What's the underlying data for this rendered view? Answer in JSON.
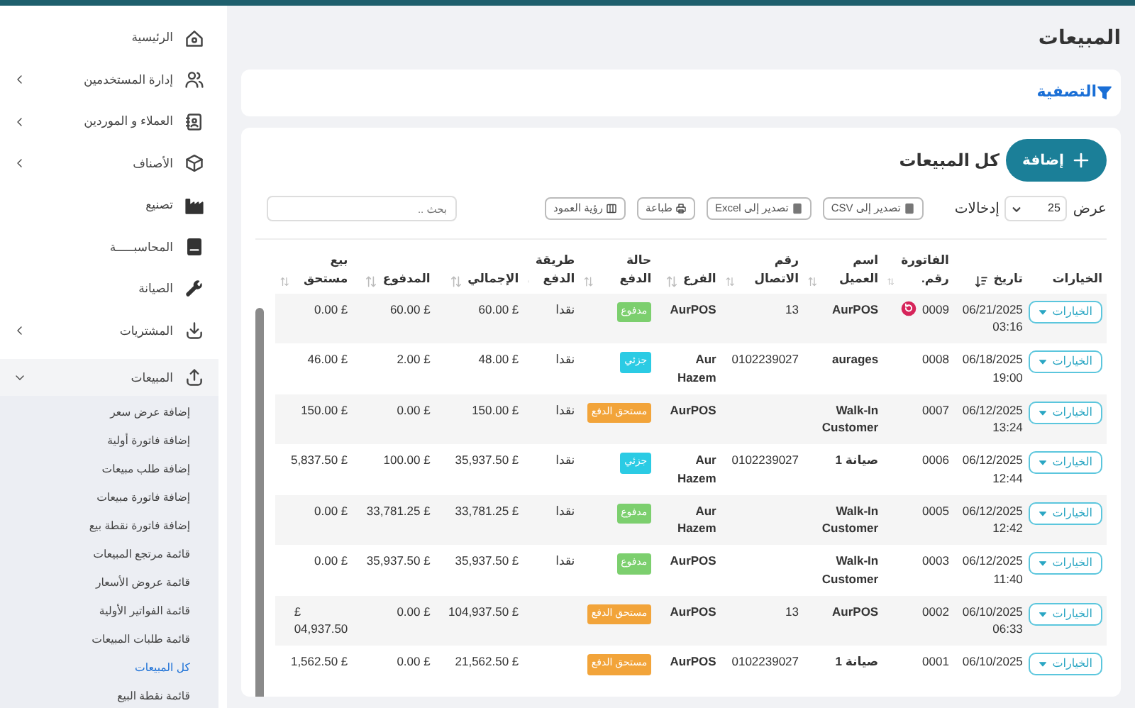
{
  "page_title": "المبيعات",
  "filter": {
    "label": "التصفية"
  },
  "card": {
    "title": "كل المبيعات",
    "add_button": "إضافة",
    "length": {
      "prefix": "عرض",
      "value": "25",
      "suffix": "إدخالات"
    },
    "tools": [
      "تصدير إلى CSV",
      "تصدير إلى Excel",
      "طباعة",
      "رؤية العمود"
    ],
    "search": {
      "placeholder": "بحث .."
    }
  },
  "table": {
    "columns": [
      {
        "label": "الخيارات",
        "sortable": false
      },
      {
        "label": "تاريخ",
        "sortable": true,
        "sorted": true
      },
      {
        "label": "الفاتورة رقم.",
        "sortable": true,
        "sorted": false
      },
      {
        "label": "اسم العميل",
        "sortable": true,
        "sorted": false
      },
      {
        "label": "رقم الاتصال",
        "sortable": true,
        "sorted": false
      },
      {
        "label": "الفرع",
        "sortable": true,
        "sorted": false
      },
      {
        "label": "حالة الدفع",
        "sortable": true,
        "sorted": false
      },
      {
        "label": "طريقة الدفع",
        "sortable": true,
        "sorted": false
      },
      {
        "label": "الإجمالي",
        "sortable": true,
        "sorted": false
      },
      {
        "label": "المدفوع",
        "sortable": true,
        "sorted": false
      },
      {
        "label": "بيع مستحق",
        "sortable": true,
        "sorted": false
      }
    ],
    "rows": [
      {
        "options": "الخيارات",
        "date": "06/21/2025\n03:16",
        "invoice": "0009",
        "returned": true,
        "customer": "AurPOS",
        "phone": "13",
        "branch": "AurPOS",
        "status": {
          "kind": "paid",
          "label": "مدفوع"
        },
        "method": "نقدا",
        "total": "60.00 £",
        "paid": "60.00 £",
        "due": "0.00 £"
      },
      {
        "options": "الخيارات",
        "date": "06/18/2025\n19:00",
        "invoice": "0008",
        "returned": false,
        "customer": "aurages",
        "phone": "0102239027",
        "branch": "Aur Hazem",
        "status": {
          "kind": "partial",
          "label": "جزئي"
        },
        "method": "نقدا",
        "total": "48.00 £",
        "paid": "2.00 £",
        "due": "46.00 £"
      },
      {
        "options": "الخيارات",
        "date": "06/12/2025\n13:24",
        "invoice": "0007",
        "returned": false,
        "customer": "Walk-In Customer",
        "branch": "AurPOS",
        "status": {
          "kind": "due",
          "label": "مستحق الدفع"
        },
        "method": "نقدا",
        "total": "150.00 £",
        "paid": "0.00 £",
        "due": "150.00 £"
      },
      {
        "options": "الخيارات",
        "date": "06/12/2025\n12:44",
        "invoice": "0006",
        "returned": false,
        "customer": "صيانة 1",
        "phone": "0102239027",
        "branch": "Aur Hazem",
        "status": {
          "kind": "partial",
          "label": "جزئي"
        },
        "method": "نقدا",
        "total": "35,937.50 £",
        "paid": "100.00 £",
        "due": "5,837.50 £"
      },
      {
        "options": "الخيارات",
        "date": "06/12/2025\n12:42",
        "invoice": "0005",
        "returned": false,
        "customer": "Walk-In Customer",
        "branch": "Aur Hazem",
        "status": {
          "kind": "paid",
          "label": "مدفوع"
        },
        "method": "نقدا",
        "total": "33,781.25 £",
        "paid": "33,781.25 £",
        "due": "0.00 £"
      },
      {
        "options": "الخيارات",
        "date": "06/12/2025\n11:40",
        "invoice": "0003",
        "returned": false,
        "customer": "Walk-In Customer",
        "branch": "AurPOS",
        "status": {
          "kind": "paid",
          "label": "مدفوع"
        },
        "method": "نقدا",
        "total": "35,937.50 £",
        "paid": "35,937.50 £",
        "due": "0.00 £"
      },
      {
        "options": "الخيارات",
        "date": "06/10/2025\n06:33",
        "invoice": "0002",
        "returned": false,
        "customer": "AurPOS",
        "phone": "13",
        "branch": "AurPOS",
        "status": {
          "kind": "due",
          "label": "مستحق الدفع"
        },
        "total": "104,937.50 £",
        "paid": "0.00 £",
        "due": "£\n04,937.50"
      },
      {
        "options": "الخيارات",
        "date": "06/10/2025",
        "invoice": "0001",
        "returned": false,
        "customer": "صيانة 1",
        "phone": "0102239027",
        "branch": "AurPOS",
        "status": {
          "kind": "due",
          "label": "مستحق الدفع"
        },
        "total": "21,562.50 £",
        "paid": "0.00 £",
        "due": "1,562.50 £"
      }
    ]
  },
  "sidebar": {
    "items": [
      {
        "kind": "link",
        "label": "الرئيسية"
      },
      {
        "kind": "group",
        "label": "إدارة المستخدمين",
        "expanded": false
      },
      {
        "kind": "group",
        "label": "العملاء و الموردين",
        "expanded": false
      },
      {
        "kind": "group",
        "label": "الأصناف",
        "expanded": false
      },
      {
        "kind": "link",
        "label": "تصنيع"
      },
      {
        "kind": "link",
        "label": "المحاسبـــــة"
      },
      {
        "kind": "link",
        "label": "الصيانة"
      },
      {
        "kind": "group",
        "label": "المشتريات",
        "expanded": false
      },
      {
        "kind": "group",
        "label": "المبيعات",
        "expanded": true,
        "children": [
          {
            "label": "إضافة عرض سعر",
            "selected": false
          },
          {
            "label": "إضافة فاتورة أولية",
            "selected": false
          },
          {
            "label": "إضافة طلب مبيعات",
            "selected": false
          },
          {
            "label": "إضافة فاتورة مبيعات",
            "selected": false
          },
          {
            "label": "إضافة فاتورة نقطة بيع",
            "selected": false
          },
          {
            "label": "قائمة مرتجع المبيعات",
            "selected": false
          },
          {
            "label": "قائمة عروض الأسعار",
            "selected": false
          },
          {
            "label": "قائمة الفواتير الأولية",
            "selected": false
          },
          {
            "label": "قائمة طلبات المبيعات",
            "selected": false
          },
          {
            "label": "كل المبيعات",
            "selected": true
          },
          {
            "label": "قائمة نقطة البيع",
            "selected": false
          }
        ]
      }
    ]
  }
}
